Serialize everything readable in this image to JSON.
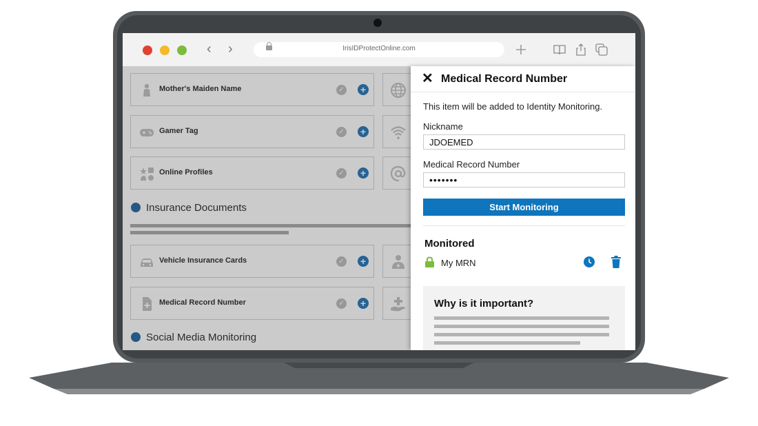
{
  "browser": {
    "url": "IrisIDProtectOnline.com",
    "back_glyph": "‹",
    "forward_glyph": "›"
  },
  "cards": [
    {
      "label": "Mother's Maiden Name",
      "icon": "person-icon"
    },
    {
      "label": "Gamer Tag",
      "icon": "gamepad-icon"
    },
    {
      "label": "Online Profiles",
      "icon": "shapes-icon"
    },
    {
      "label": "Vehicle Insurance Cards",
      "icon": "car-icon"
    },
    {
      "label": "Medical Record Number",
      "icon": "medical-document-icon"
    }
  ],
  "side_icons": [
    "globe-icon",
    "wifi-icon",
    "at-sign-icon",
    "doctor-icon",
    "hand-medical-icon"
  ],
  "sections": {
    "insurance": "Insurance Documents",
    "social": "Social Media Monitoring"
  },
  "panel": {
    "title": "Medical Record Number",
    "description": "This item will be added to Identity Monitoring.",
    "nickname_label": "Nickname",
    "nickname_value": "JDOEMED",
    "mrn_label": "Medical Record Number",
    "mrn_value": "•••••••",
    "start_button": "Start Monitoring",
    "monitored_title": "Monitored",
    "monitored_item": "My MRN",
    "why_title": "Why is it important?"
  },
  "colors": {
    "accent_blue": "#0f75bc",
    "lock_green": "#7cbc3a",
    "section_dot": "#1b5fa0"
  }
}
